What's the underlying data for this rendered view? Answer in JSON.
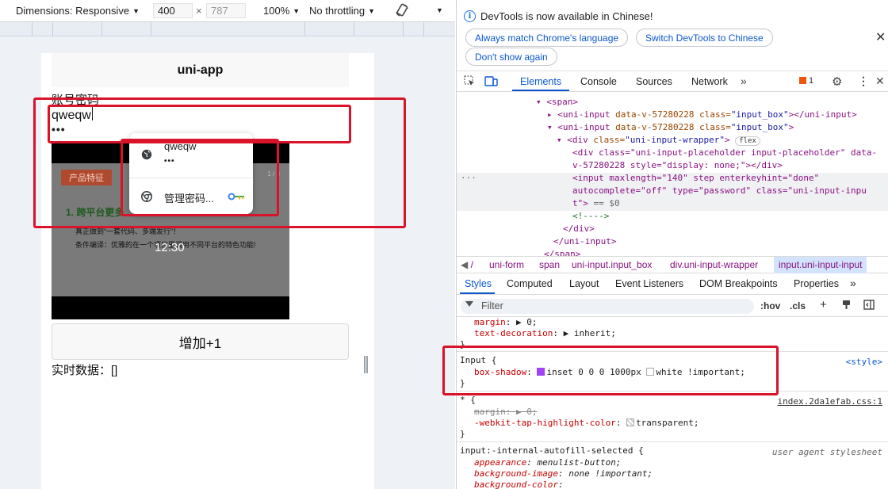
{
  "device_toolbar": {
    "dimensions_label": "Dimensions: Responsive",
    "width": "400",
    "times": "×",
    "height": "787",
    "zoom": "100%",
    "throttling": "No throttling"
  },
  "app": {
    "nav_title": "uni-app",
    "account_label": "账号密码",
    "username_value": "qweqw",
    "password_mask": "•••",
    "video": {
      "tag": "产品特征",
      "page_indicator": "1 / 3",
      "heading": "1. 跨平台更多",
      "line1": "真正做到“一套代码、多端发行”！",
      "line2": "条件编译：优雅的在一个项目里调用不同平台的特色功能!",
      "time": "12:30"
    },
    "add_button": "增加+1",
    "realtime": "实时数据：[]"
  },
  "autofill": {
    "username": "qweqw",
    "password_mask": "•••",
    "manage": "管理密码..."
  },
  "devtools": {
    "banner": {
      "message": "DevTools is now available in Chinese!",
      "btn_match": "Always match Chrome's language",
      "btn_switch": "Switch DevTools to Chinese",
      "btn_dont": "Don't show again"
    },
    "tabs": [
      "Elements",
      "Console",
      "Sources",
      "Network"
    ],
    "error_count": "1",
    "dom": {
      "l1": "<span>",
      "l2_tag": "<uni-input",
      "l2_attr1": " data-v-57280228",
      "l2_attr2": " class=",
      "l2_val": "\"input_box\"",
      "l2_end": "></uni-input>",
      "l3_end": ">",
      "l4_tag": "<div",
      "l4_attr": " class=",
      "l4_val": "\"uni-input-wrapper\"",
      "l4_badge": "flex",
      "l5a": "<div class=\"uni-input-placeholder input-placeholder\" data-",
      "l5b": "v-57280228 style=\"display: none;\"></div>",
      "l6a": "<input maxlength=\"140\" step enterkeyhint=\"done\"",
      "l6b": "autocomplete=\"off\" type=\"password\" class=\"uni-input-inpu",
      "l6c": "t\">",
      "l6d": " == $0",
      "l7": "<!---->",
      "l8": "</div>",
      "l9": "</uni-input>",
      "l10": "</span>"
    },
    "breadcrumb": [
      "uni-form",
      "span",
      "uni-input.input_box",
      "div.uni-input-wrapper",
      "input.uni-input-input"
    ],
    "subtabs": [
      "Styles",
      "Computed",
      "Layout",
      "Event Listeners",
      "DOM Breakpoints",
      "Properties"
    ],
    "filter_placeholder": "Filter",
    "hov": ":hov",
    "cls": ".cls",
    "styles": {
      "r0_prop1": "margin",
      "r0_val1": "▶ 0;",
      "r0_prop2": "text-decoration",
      "r0_val2": "▶ inherit;",
      "close": "}",
      "r1_selector": "Input {",
      "r1_source": "<style>",
      "r1_prop": "box-shadow",
      "r1_val1": "inset 0 0 0 1000px",
      "r1_val2": "white !important;",
      "r2_selector": "* {",
      "r2_source": "index.2da1efab.css:1",
      "r2_prop1": "margin",
      "r2_val1": "▶ 0;",
      "r2_prop2": "-webkit-tap-highlight-color",
      "r2_val2": "transparent;",
      "r3_selector": "input:-internal-autofill-selected {",
      "r3_source": "user agent stylesheet",
      "r3_prop1": "appearance",
      "r3_val1": "menulist-button;",
      "r3_prop2": "background-image",
      "r3_val2": "none !important;",
      "r3_prop3": "background-color",
      "r3_val3": ""
    }
  },
  "colors": {
    "accent": "#0b57d0",
    "highlight_border": "#d8132a",
    "tag": "#881280"
  }
}
